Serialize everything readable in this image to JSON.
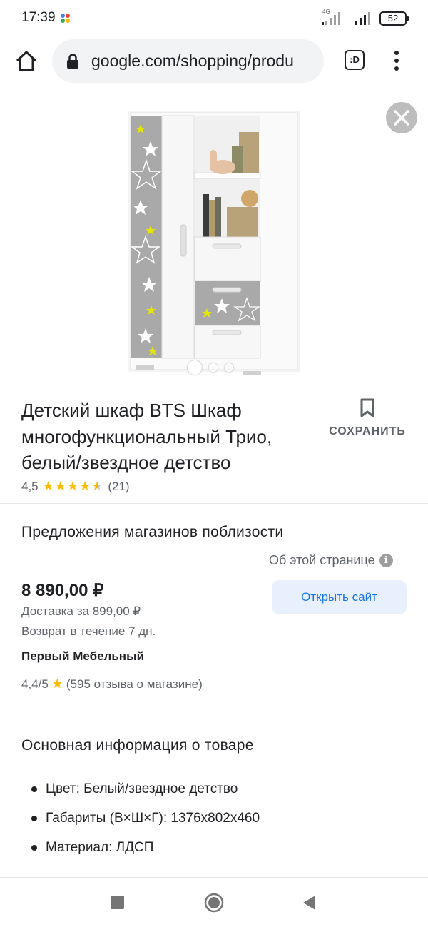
{
  "status": {
    "time": "17:39",
    "network": "4G",
    "battery": "52"
  },
  "browser": {
    "url": "google.com/shopping/produ",
    "tabs_label": ":D"
  },
  "product": {
    "title": "Детский шкаф BTS Шкаф многофункциональный Трио, белый/звездное детство",
    "rating": "4,5",
    "stars_fraction": 0.9,
    "reviews": "(21)",
    "save_label": "СОХРАНИТЬ",
    "image_count": 3,
    "active_image": 1
  },
  "offers": {
    "title": "Предложения магазинов поблизости",
    "about_page": "Об этой странице",
    "price": "8 890,00 ₽",
    "open_site": "Открыть сайт",
    "delivery": "Доставка за 899,00 ₽",
    "return": "Возврат в течение 7 дн.",
    "store": "Первый Мебельный",
    "store_rating": "4,4/5",
    "store_reviews": "595 отзыва о магазине"
  },
  "info": {
    "title": "Основная информация о товаре",
    "specs": [
      "Цвет: Белый/звездное детство",
      "Габариты (В×Ш×Г): 1376x802x460",
      "Материал: ЛДСП"
    ]
  },
  "colors": {
    "accent": "#1a73e8",
    "star": "#fbbc04",
    "button_bg": "#e8f0fe"
  }
}
